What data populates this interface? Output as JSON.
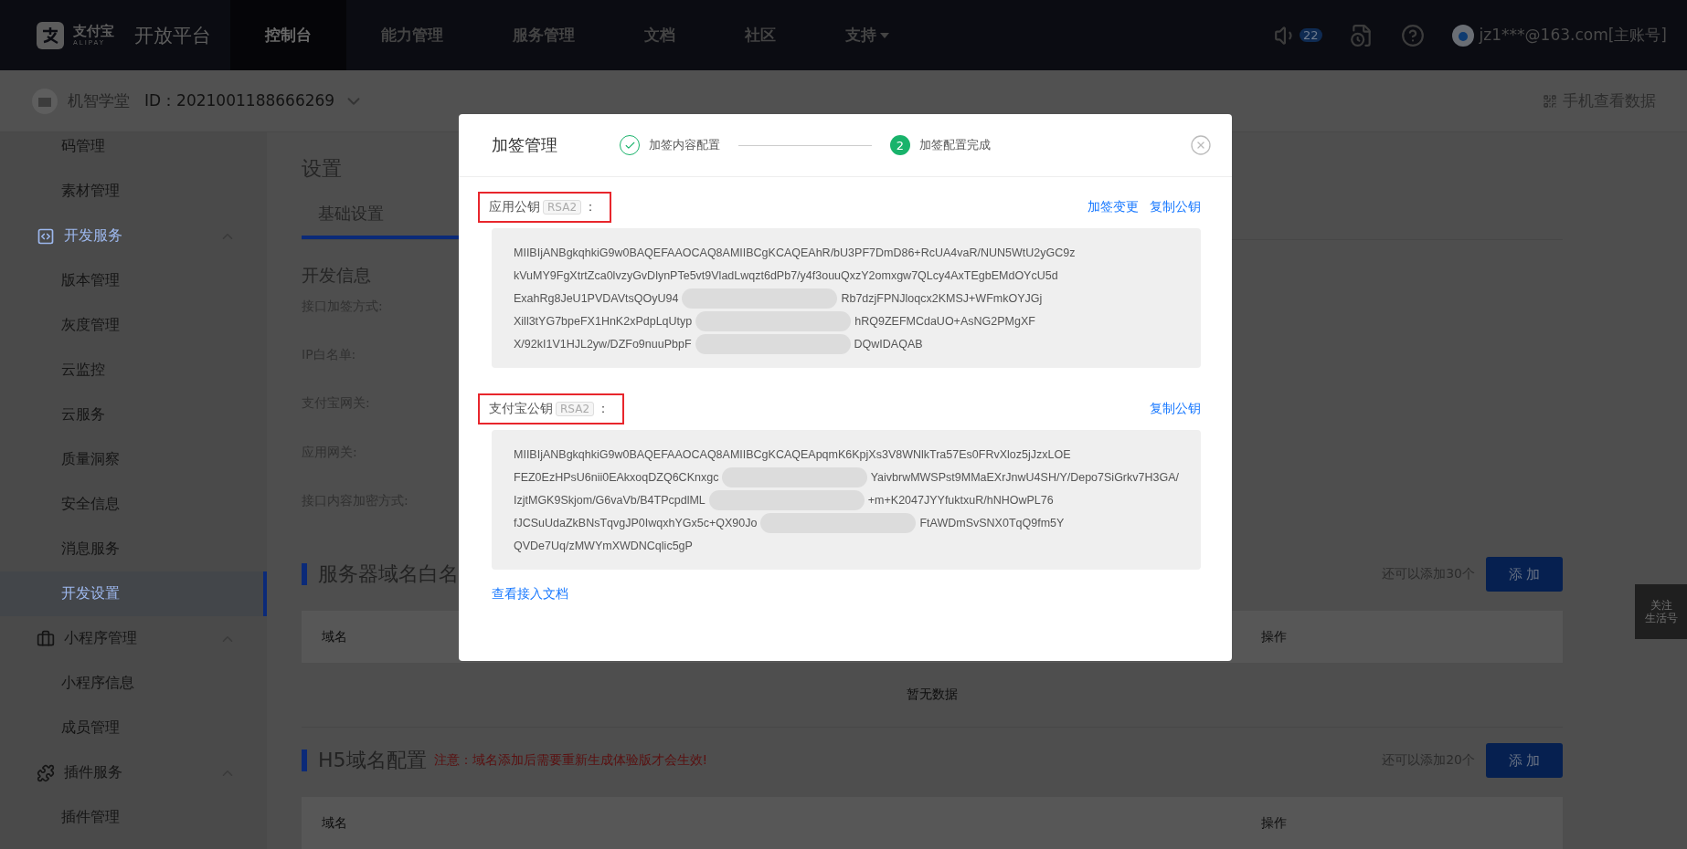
{
  "top_nav": {
    "logo": {
      "name": "支付宝",
      "latin": "ALIPAY"
    },
    "platform": "开放平台",
    "items": [
      {
        "label": "控制台",
        "selected": true,
        "caret": false
      },
      {
        "label": "能力管理",
        "selected": false,
        "caret": false
      },
      {
        "label": "服务管理",
        "selected": false,
        "caret": false
      },
      {
        "label": "文档",
        "selected": false,
        "caret": false
      },
      {
        "label": "社区",
        "selected": false,
        "caret": false
      },
      {
        "label": "支持",
        "selected": false,
        "caret": true
      }
    ],
    "notice_count": "22",
    "account": "jz1***@163.com[主账号]"
  },
  "sub_header": {
    "app_name": "机智学堂",
    "app_id": "ID：2021001188666269",
    "mobile_link": "手机查看数据"
  },
  "sidebar": {
    "items": [
      {
        "kind": "child",
        "label": "码管理",
        "selected": false
      },
      {
        "kind": "child",
        "label": "素材管理",
        "selected": false
      },
      {
        "kind": "group",
        "label": "开发服务",
        "active": true,
        "expanded": true
      },
      {
        "kind": "child",
        "label": "版本管理",
        "selected": false
      },
      {
        "kind": "child",
        "label": "灰度管理",
        "selected": false
      },
      {
        "kind": "child",
        "label": "云监控",
        "selected": false
      },
      {
        "kind": "child",
        "label": "云服务",
        "selected": false
      },
      {
        "kind": "child",
        "label": "质量洞察",
        "selected": false
      },
      {
        "kind": "child",
        "label": "安全信息",
        "selected": false
      },
      {
        "kind": "child",
        "label": "消息服务",
        "selected": false
      },
      {
        "kind": "child",
        "label": "开发设置",
        "selected": true
      },
      {
        "kind": "group",
        "label": "小程序管理",
        "active": false,
        "expanded": true
      },
      {
        "kind": "child",
        "label": "小程序信息",
        "selected": false
      },
      {
        "kind": "child",
        "label": "成员管理",
        "selected": false
      },
      {
        "kind": "group",
        "label": "插件服务",
        "active": false,
        "expanded": true
      },
      {
        "kind": "child",
        "label": "插件管理",
        "selected": false
      }
    ]
  },
  "main": {
    "title": "设置",
    "tabs": [
      {
        "label": "基础设置",
        "selected": true
      }
    ],
    "dev_info": {
      "heading": "开发信息",
      "fields": [
        "接口加签方式:",
        "IP白名单:",
        "支付宝网关:",
        "应用网关:",
        "接口内容加密方式:"
      ]
    },
    "sections": [
      {
        "heading": "服务器域名白名",
        "remaining": "还可以添加30个",
        "button": "添 加",
        "columns": [
          "域名",
          "操作"
        ],
        "empty_text": "暂无数据"
      },
      {
        "heading": "H5域名配置",
        "note": "注意：域名添加后需要重新生成体验版才会生效!",
        "remaining": "还可以添加20个",
        "button": "添 加",
        "columns": [
          "域名",
          "操作"
        ]
      }
    ]
  },
  "float_button": {
    "lines": [
      "关注",
      "生活号"
    ]
  },
  "modal": {
    "title": "加签管理",
    "steps": [
      {
        "label": "加签内容配置",
        "done": true
      },
      {
        "label": "加签配置完成",
        "done": false,
        "number": "2"
      }
    ],
    "keys": [
      {
        "label": "应用公钥",
        "badge": "RSA2",
        "colon": "：",
        "highlighted": true,
        "links": [
          "加签变更",
          "复制公钥"
        ],
        "lines": [
          {
            "left": "MIIBIjANBgkqhkiG9w0BAQEFAAOCAQ8AMIIBCgKCAQEAhR/bU3PF7DmD86+RcUA4vaR/NUN5WtU2yGC9z"
          },
          {
            "left": "kVuMY9FgXtrtZca0lvzyGvDlynPTe5vt9VladLwqzt6dPb7/y4f3ouuQxzY2omxgw7QLcy4AxTEgbEMdOYcU5d"
          },
          {
            "left": "ExahRg8JeU1PVDAVtsQOyU94",
            "right": "Rb7dzjFPNJloqcx2KMSJ+WFmkOYJGj"
          },
          {
            "left": "Xill3tYG7bpeFX1HnK2xPdpLqUtyp",
            "right": "hRQ9ZEFMCdaUO+AsNG2PMgXF"
          },
          {
            "left": "X/92kI1V1HJL2yw/DZFo9nuuPbpF",
            "right": "DQwIDAQAB"
          }
        ]
      },
      {
        "label": "支付宝公钥",
        "badge": "RSA2",
        "colon": "：",
        "highlighted": true,
        "links": [
          "复制公钥"
        ],
        "lines": [
          {
            "left": "MIIBIjANBgkqhkiG9w0BAQEFAAOCAQ8AMIIBCgKCAQEApqmK6KpjXs3V8WNlkTra57Es0FRvXloz5jJzxLOE"
          },
          {
            "left": "FEZ0EzHPsU6nii0EAkxoqDZQ6CKnxgc",
            "right": "YaivbrwMWSPst9MMaEXrJnwU4SH/Y/Depo7SiGrkv7H3GA/"
          },
          {
            "left": "IzjtMGK9Skjom/G6vaVb/B4TPcpdlML",
            "right": "+m+K2047JYYfuktxuR/hNHOwPL76"
          },
          {
            "left": "fJCSuUdaZkBNsTqvgJP0IwqxhYGx5c+QX90Jo",
            "right": "FtAWDmSvSNX0TqQ9fm5Y"
          },
          {
            "left": "QVDe7Uq/zMWYmXWDNCqlic5gP"
          }
        ]
      }
    ],
    "doc_link": "查看接入文档"
  }
}
